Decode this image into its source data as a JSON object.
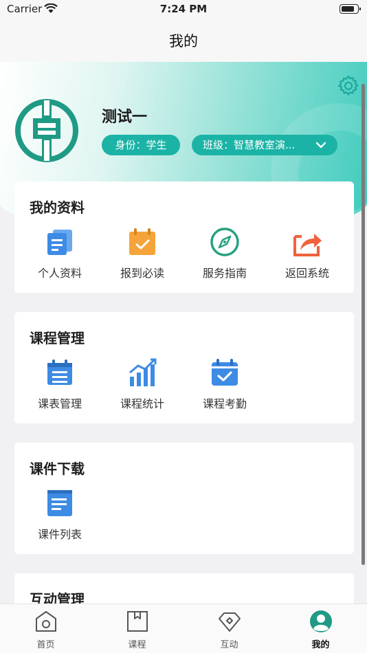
{
  "status_bar": {
    "carrier": "Carrier",
    "time": "7:24 PM"
  },
  "nav": {
    "title": "我的"
  },
  "profile": {
    "name": "测试一",
    "role": "身份：学生",
    "class": "班级：智慧教室演..."
  },
  "sections": [
    {
      "title": "我的资料",
      "items": [
        {
          "label": "个人资料",
          "icon": "profile-doc-icon"
        },
        {
          "label": "报到必读",
          "icon": "calendar-check-icon"
        },
        {
          "label": "服务指南",
          "icon": "compass-icon"
        },
        {
          "label": "返回系统",
          "icon": "share-exit-icon"
        }
      ]
    },
    {
      "title": "课程管理",
      "items": [
        {
          "label": "课表管理",
          "icon": "schedule-icon"
        },
        {
          "label": "课程统计",
          "icon": "statistics-icon"
        },
        {
          "label": "课程考勤",
          "icon": "attendance-icon"
        }
      ]
    },
    {
      "title": "课件下载",
      "items": [
        {
          "label": "课件列表",
          "icon": "file-list-icon"
        }
      ]
    },
    {
      "title": "互动管理",
      "items": []
    }
  ],
  "tabs": [
    {
      "label": "首页",
      "icon": "home-icon"
    },
    {
      "label": "课程",
      "icon": "book-icon"
    },
    {
      "label": "互动",
      "icon": "diamond-icon"
    },
    {
      "label": "我的",
      "icon": "user-icon",
      "active": true
    }
  ],
  "colors": {
    "accent": "#1bb3a6",
    "blue": "#3d8be4",
    "orange": "#f5a43b",
    "green": "#26a17f",
    "red": "#f0623f"
  }
}
